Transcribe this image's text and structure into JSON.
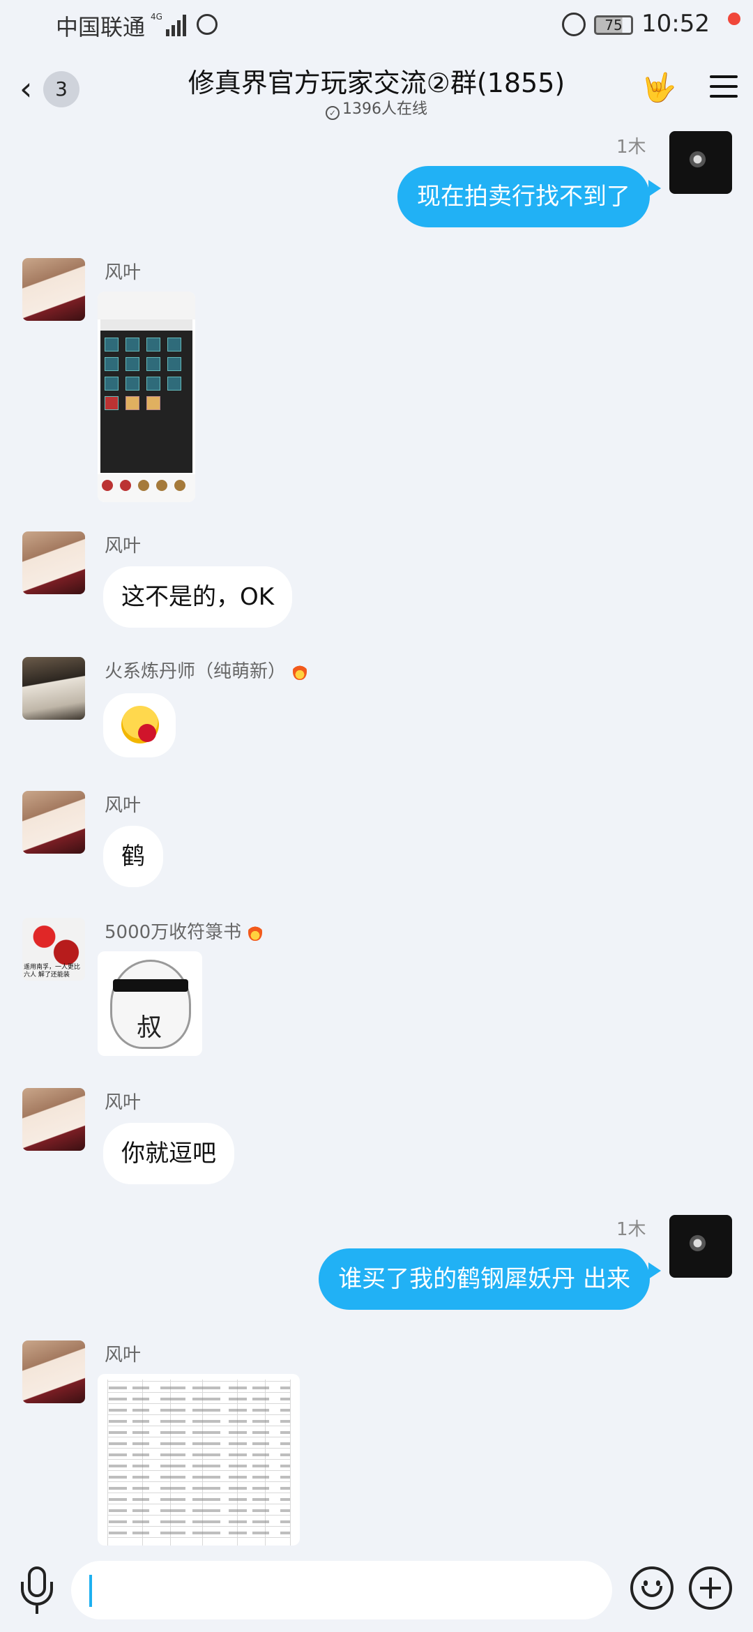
{
  "status_bar": {
    "carrier": "中国联通",
    "network": "4G",
    "battery": "75",
    "time": "10:52"
  },
  "header": {
    "unread_count": "3",
    "title": "修真界官方玩家交流②群(1855)",
    "online": "1396人在线"
  },
  "messages": [
    {
      "sender": "me",
      "time_label": "1木",
      "text": "现在拍卖行找不到了"
    },
    {
      "sender": "风叶",
      "type": "image",
      "image_desc": "game-screenshot"
    },
    {
      "sender": "风叶",
      "text": "这不是的，OK"
    },
    {
      "sender": "火系炼丹师（纯萌新）",
      "type": "emoji",
      "emoji": "puking-blood-emoji"
    },
    {
      "sender": "风叶",
      "text": "鹤"
    },
    {
      "sender": "5000万收符箓书",
      "type": "sticker",
      "sticker_glyph": "叔"
    },
    {
      "sender": "风叶",
      "text": "你就逗吧"
    },
    {
      "sender": "me",
      "time_label": "1木",
      "text": "谁买了我的鹤钢犀妖丹  出来"
    },
    {
      "sender": "风叶",
      "type": "image",
      "image_desc": "spreadsheet-screenshot"
    }
  ],
  "avatars": {
    "panda_caption": "遥用南孚，一人更比六人 解了还能装"
  },
  "input_bar": {
    "value": "",
    "placeholder": ""
  },
  "colors": {
    "accent": "#21b1f5",
    "background": "#f0f3f8",
    "notification_dot": "#f0473a"
  }
}
